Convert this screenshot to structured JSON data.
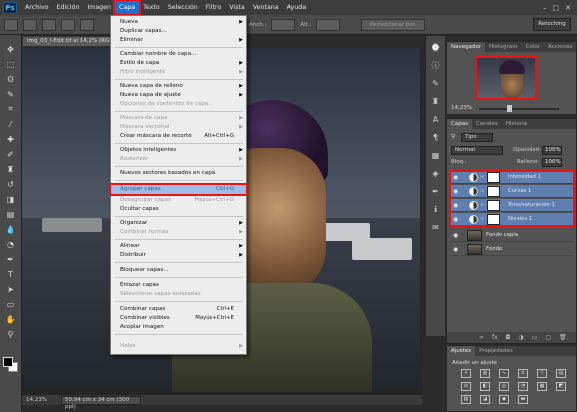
{
  "menubar": {
    "logo": "Ps",
    "items": [
      "Archivo",
      "Edición",
      "Imagen",
      "Capa",
      "Texto",
      "Selección",
      "Filtro",
      "Vista",
      "Ventana",
      "Ayuda"
    ],
    "active_item": "Capa",
    "window_controls": [
      "–",
      "□",
      "✕"
    ]
  },
  "options": {
    "ancho_label": "Anch.:",
    "alto_label": "Alt.:",
    "perfilar_button": "Perfeccionar bor.",
    "workspace": "Retoching"
  },
  "document": {
    "tab_title": "img_03_l-Edit.tif al 14,2% (RGB/8)",
    "zoom": "14,23%",
    "size": "50,94 cm x 34 cm (300 ppi)"
  },
  "capa_menu": {
    "items": [
      {
        "label": "Nueva",
        "submenu": true
      },
      {
        "label": "Duplicar capas..."
      },
      {
        "label": "Eliminar",
        "submenu": true
      },
      {
        "label": "Cambiar nombre de capa..."
      },
      {
        "label": "Estilo de capa",
        "submenu": true
      },
      {
        "label": "Filtro inteligente",
        "disabled": true,
        "submenu": true
      },
      {
        "label": "Nueva capa de relleno",
        "submenu": true
      },
      {
        "label": "Nueva capa de ajuste",
        "submenu": true
      },
      {
        "label": "Opciones de contenido de capa...",
        "disabled": true
      },
      {
        "label": "Máscara de capa",
        "disabled": true,
        "submenu": true
      },
      {
        "label": "Máscara vectorial",
        "disabled": true,
        "submenu": true
      },
      {
        "label": "Crear máscara de recorte",
        "shortcut": "Alt+Ctrl+G"
      },
      {
        "label": "Objetos inteligentes",
        "submenu": true
      },
      {
        "label": "Rasterizar",
        "disabled": true,
        "submenu": true
      },
      {
        "label": "Nuevos sectores basados en capa"
      },
      {
        "label": "Agrupar capas",
        "shortcut": "Ctrl+G",
        "highlighted": true
      },
      {
        "label": "Desagrupar capas",
        "shortcut": "Mayús+Ctrl+G",
        "disabled": true
      },
      {
        "label": "Ocultar capas"
      },
      {
        "label": "Organizar",
        "submenu": true
      },
      {
        "label": "Combinar formas",
        "disabled": true,
        "submenu": true
      },
      {
        "label": "Alinear",
        "submenu": true
      },
      {
        "label": "Distribuir",
        "submenu": true
      },
      {
        "label": "Bloquear capas..."
      },
      {
        "label": "Enlazar capas"
      },
      {
        "label": "Seleccionar capas enlazadas",
        "disabled": true
      },
      {
        "label": "Combinar capas",
        "shortcut": "Ctrl+E"
      },
      {
        "label": "Combinar visibles",
        "shortcut": "Mayús+Ctrl+E"
      },
      {
        "label": "Acoplar imagen"
      },
      {
        "label": "Halos",
        "disabled": true,
        "submenu": true
      }
    ]
  },
  "navigator": {
    "tabs": [
      "Navegador",
      "Histogram",
      "Color",
      "Acciones"
    ],
    "zoom": "14,23%"
  },
  "layers_panel": {
    "tabs": [
      "Capas",
      "Canales",
      "Historia"
    ],
    "filter": "Tipo",
    "blend_mode": "Normal",
    "opacity_label": "Opacidad:",
    "opacity": "100%",
    "lock_label": "Bloq.:",
    "fill_label": "Relleno:",
    "fill": "100%",
    "layers": [
      {
        "name": "Intensidad 1",
        "type": "adjustment",
        "selected": true
      },
      {
        "name": "Curvas 1",
        "type": "adjustment",
        "selected": true
      },
      {
        "name": "Tono/saturación 1",
        "type": "adjustment",
        "selected": true
      },
      {
        "name": "Niveles 1",
        "type": "adjustment",
        "selected": true
      },
      {
        "name": "Fondo capia",
        "type": "pixel",
        "selected": false
      },
      {
        "name": "Fondo",
        "type": "pixel",
        "selected": false,
        "italic": true
      }
    ]
  },
  "adjustments_panel": {
    "tabs": [
      "Ajustes",
      "Propiedades"
    ],
    "title": "Añadir un ajuste"
  }
}
